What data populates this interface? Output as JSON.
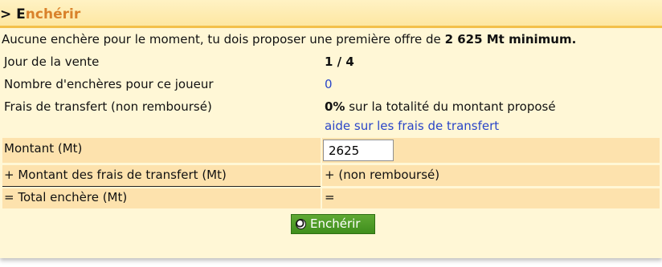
{
  "header": {
    "prefix": "> ",
    "first_letter": "E",
    "rest": "nchérir"
  },
  "intro": {
    "text": "Aucune enchère pour le moment, tu dois proposer une première offre de ",
    "amount": "2 625 Mt minimum."
  },
  "info": {
    "day_label": "Jour de la vente",
    "day_value": "1 / 4",
    "bids_label": "Nombre d'enchères pour ce joueur",
    "bids_value": "0",
    "fee_label": "Frais de transfert (non remboursé)",
    "fee_percent": "0%",
    "fee_text": " sur la totalité du montant proposé",
    "fee_help_link": "aide sur les frais de transfert"
  },
  "form": {
    "amount_label": "Montant (Mt)",
    "amount_value": "2625",
    "fees_label": "+ Montant des frais de transfert (Mt)",
    "fees_value": "+ (non remboursé)",
    "total_label": "= Total enchère (Mt)",
    "total_value": "="
  },
  "submit": {
    "label": "Enchérir",
    "icon": "soccer-ball-icon"
  },
  "colors": {
    "panel_bg": "#fff7d6",
    "header_accent": "#d9822b",
    "form_row_bg": "#fde2ad",
    "link": "#2a46c8",
    "button_green": "#4c9b28"
  }
}
